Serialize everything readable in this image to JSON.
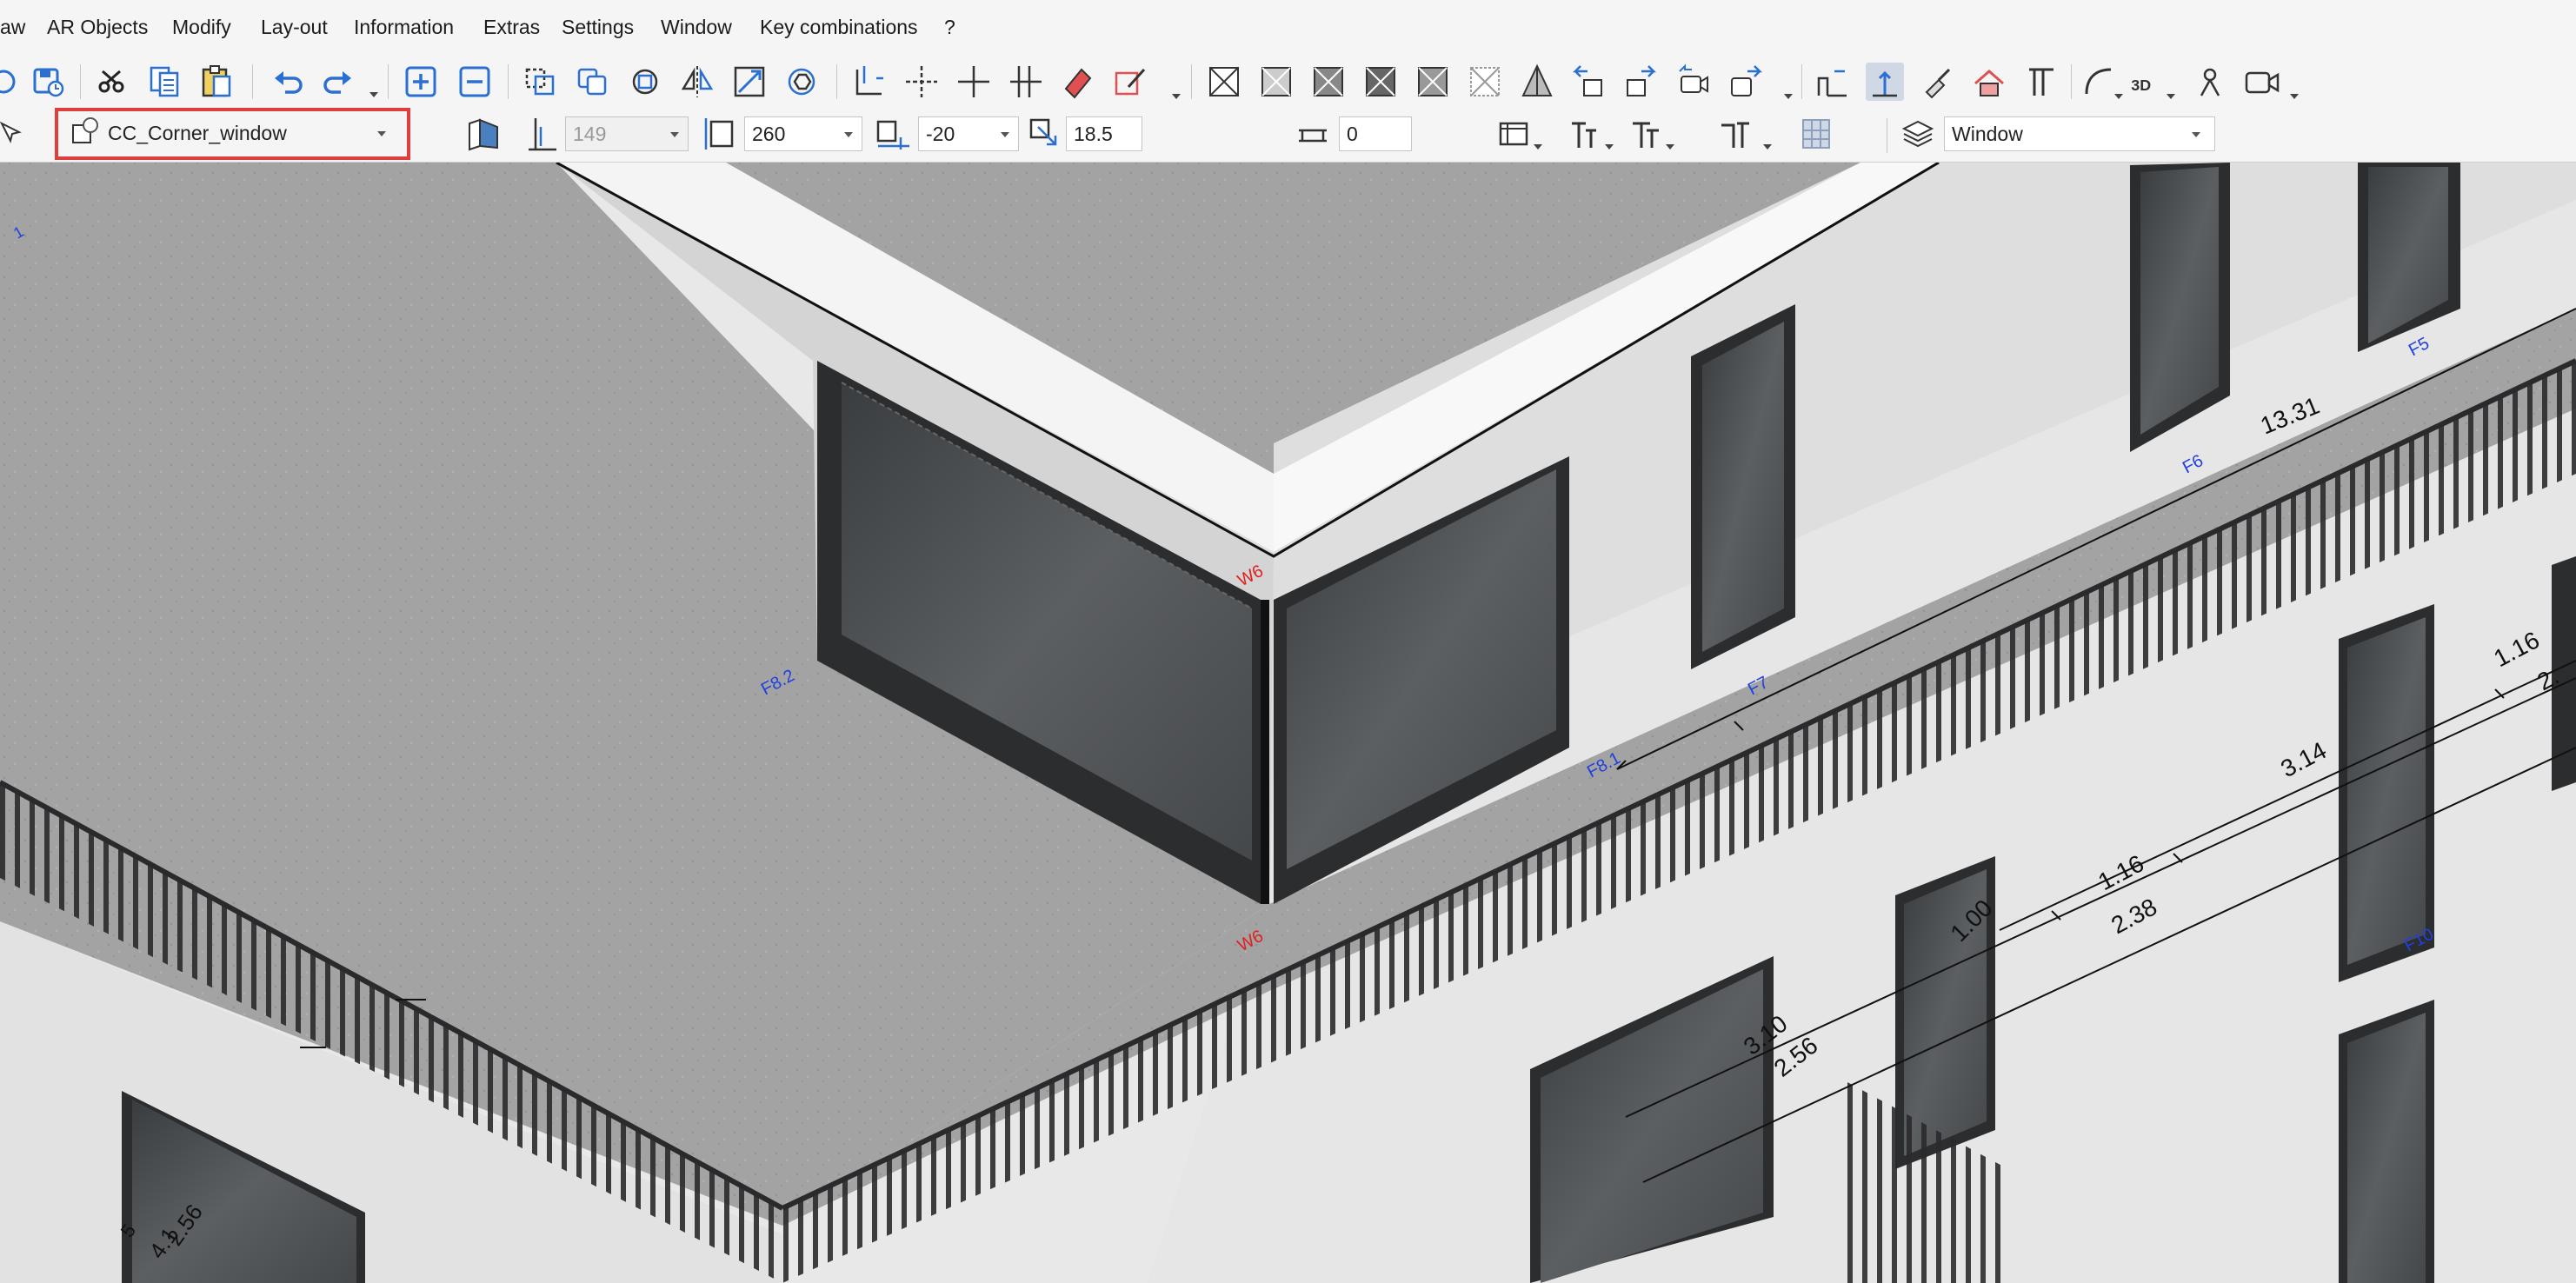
{
  "menu": [
    "aw",
    "AR Objects",
    "Modify",
    "Lay-out",
    "Information",
    "Extras",
    "Settings",
    "Window",
    "Key combinations",
    "?"
  ],
  "toolbar2": {
    "object_name": "CC_Corner_window",
    "field_149": "149",
    "field_height": "260",
    "field_offset": "-20",
    "field_thickness": "18.5",
    "field_zero": "0",
    "layer": "Window"
  },
  "viewport": {
    "labels": {
      "w6_top": "W6",
      "w6_bottom": "W6",
      "f8_2": "F8.2",
      "f8_1": "F8.1",
      "f7": "F7",
      "f6": "F6",
      "f5": "F5",
      "f10": "F10",
      "dim_13_31": "13.31",
      "dim_1_16_a": "1.16",
      "dim_2_x": "2.",
      "dim_3_14": "3.14",
      "dim_1_16_b": "1.16",
      "dim_2_38": "2.38",
      "dim_1_00": "1.00",
      "dim_3_10": "3.10",
      "dim_2_56": "2.56",
      "dim_2_56_b": "2.56",
      "dim_4_1": "4.1",
      "dim_5": "5",
      "dim_1": "1"
    }
  },
  "colors": {
    "accent_highlight": "#e03d3d",
    "icon_blue": "#1f5fbf",
    "label_red": "#e02020",
    "label_blue": "#2040e0"
  }
}
